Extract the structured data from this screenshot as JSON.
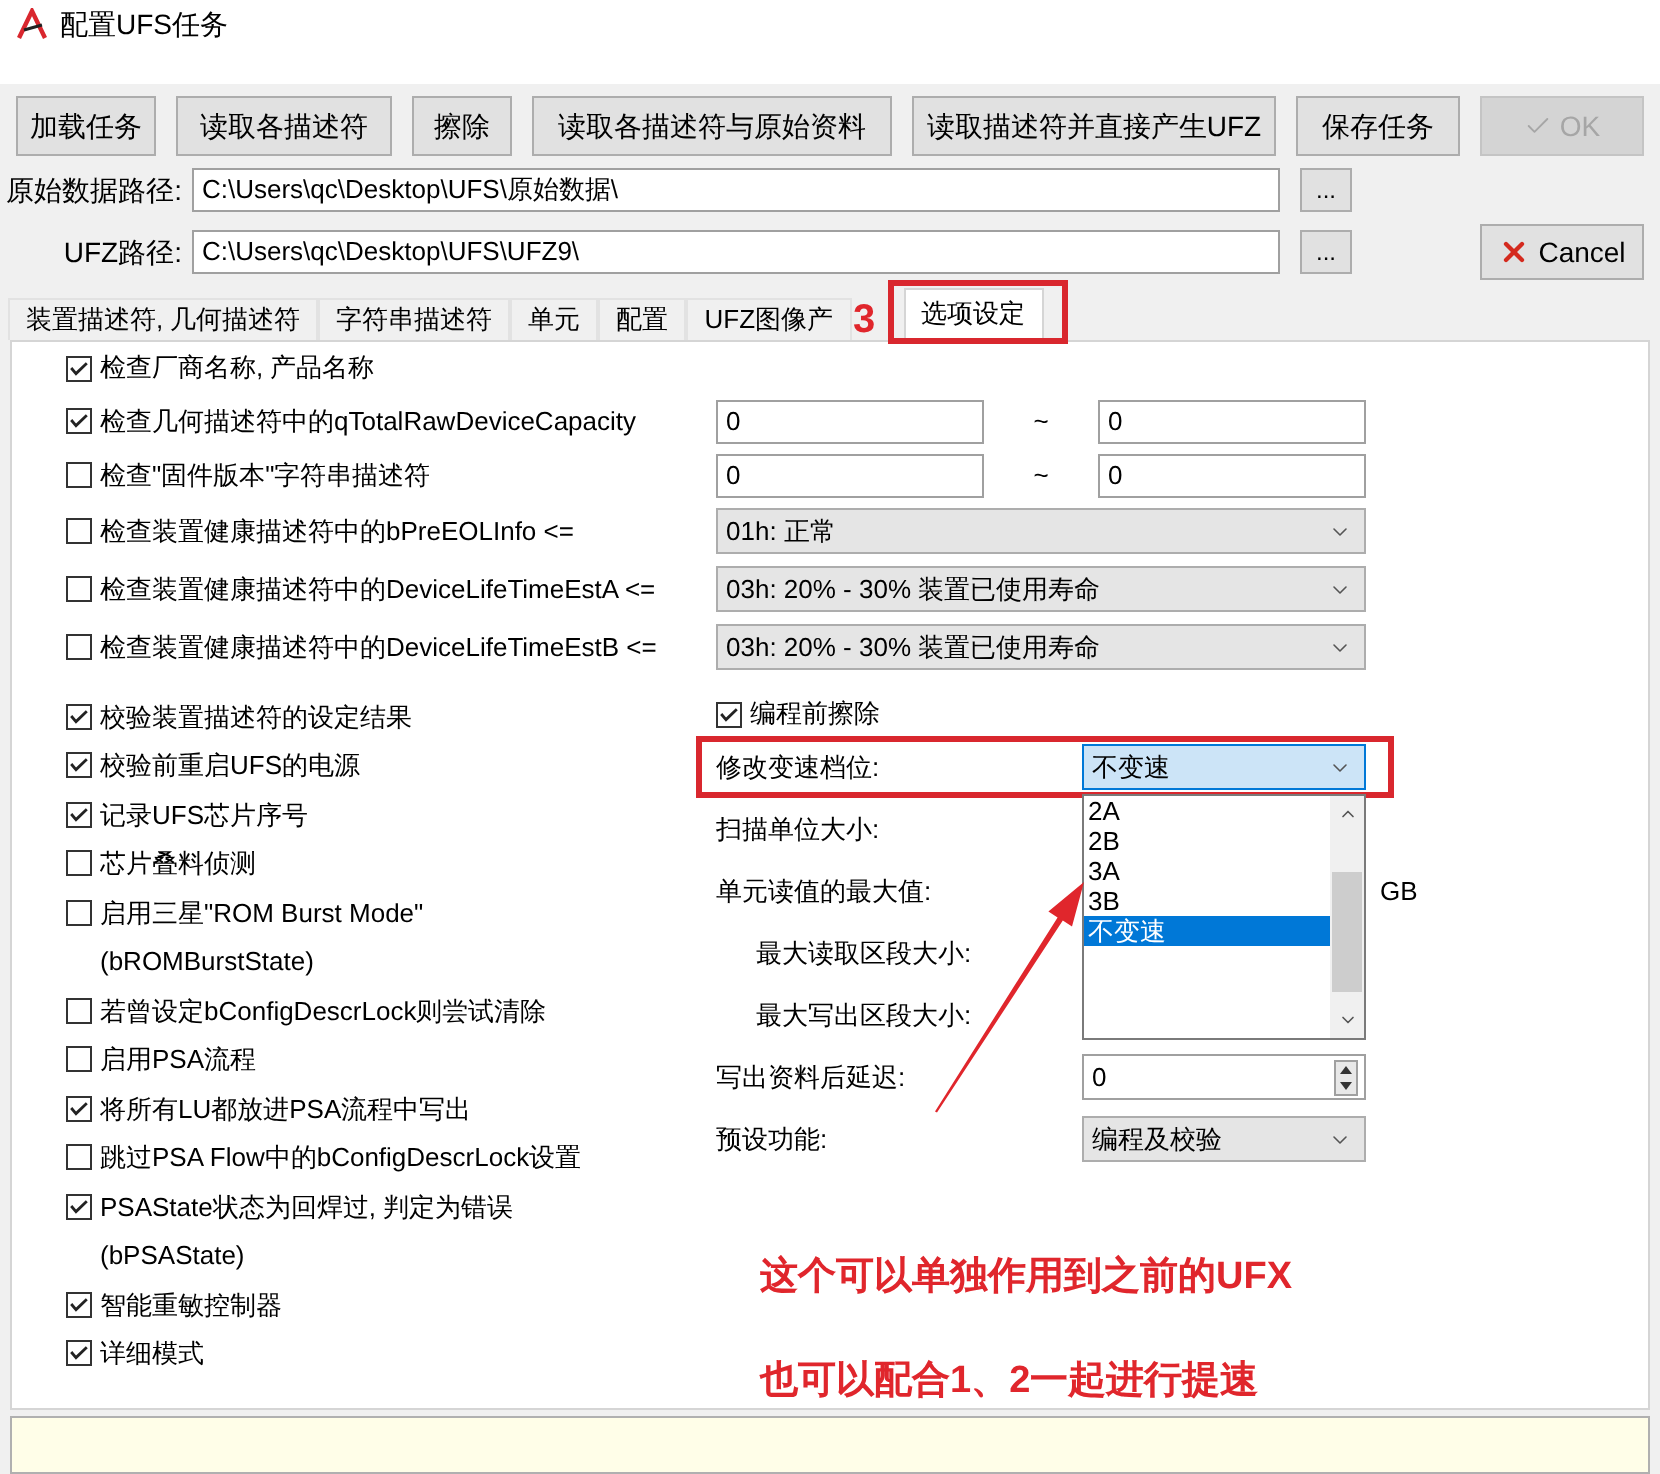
{
  "window": {
    "title": "配置UFS任务"
  },
  "toolbar": {
    "buttons": [
      {
        "label": "加载任务"
      },
      {
        "label": "读取各描述符"
      },
      {
        "label": "擦除"
      },
      {
        "label": "读取各描述符与原始资料"
      },
      {
        "label": "读取描述符并直接产生UFZ"
      },
      {
        "label": "保存任务"
      }
    ],
    "ok": {
      "label": "OK",
      "disabled": true
    }
  },
  "paths": [
    {
      "label": "原始数据路径:",
      "value": "C:\\Users\\qc\\Desktop\\UFS\\原始数据\\",
      "browse": "..."
    },
    {
      "label": "UFZ路径:",
      "value": "C:\\Users\\qc\\Desktop\\UFS\\UFZ9\\",
      "browse": "..."
    }
  ],
  "cancel": {
    "label": "Cancel"
  },
  "tabs": [
    {
      "label": "装置描述符, 几何描述符",
      "selected": false,
      "annotated": false
    },
    {
      "label": "字符串描述符",
      "selected": false,
      "annotated": false
    },
    {
      "label": "单元",
      "selected": false,
      "annotated": false
    },
    {
      "label": "配置",
      "selected": false,
      "annotated": false
    },
    {
      "label": "UFZ图像产",
      "selected": false,
      "annotated": false
    },
    {
      "label": "选项设定",
      "selected": true,
      "annotated": true
    }
  ],
  "tab_marker": "3",
  "top_rows": [
    {
      "label": "检查厂商名称, 产品名称",
      "checked": true
    },
    {
      "label": "检查几何描述符中的qTotalRawDeviceCapacity",
      "checked": true,
      "control": {
        "kind": "range",
        "from": "0",
        "separator": "~",
        "to": "0"
      }
    },
    {
      "label": "检查\"固件版本\"字符串描述符",
      "checked": false,
      "control": {
        "kind": "range",
        "from": "0",
        "separator": "~",
        "to": "0"
      }
    },
    {
      "label": "检查装置健康描述符中的bPreEOLInfo <=",
      "checked": false,
      "control": {
        "kind": "select",
        "value": "01h: 正常"
      }
    },
    {
      "label": "检查装置健康描述符中的DeviceLifeTimeEstA <=",
      "checked": false,
      "control": {
        "kind": "select",
        "value": "03h: 20% - 30% 装置已使用寿命"
      }
    },
    {
      "label": "检查装置健康描述符中的DeviceLifeTimeEstB <=",
      "checked": false,
      "control": {
        "kind": "select",
        "value": "03h: 20% - 30% 装置已使用寿命"
      }
    }
  ],
  "left_options": [
    {
      "label": "校验装置描述符的设定结果",
      "checked": true
    },
    {
      "label": "校验前重启UFS的电源",
      "checked": true
    },
    {
      "label": "记录UFS芯片序号",
      "checked": true
    },
    {
      "label": "芯片叠料侦测",
      "checked": false
    },
    {
      "label": "启用三星\"ROM Burst Mode\"",
      "note": "(bROMBurstState)",
      "checked": false
    },
    {
      "label": "若曾设定bConfigDescrLock则尝试清除",
      "checked": false
    },
    {
      "label": "启用PSA流程",
      "checked": false
    },
    {
      "label": "将所有LU都放进PSA流程中写出",
      "checked": true
    },
    {
      "label": "跳过PSA Flow中的bConfigDescrLock设置",
      "checked": false
    },
    {
      "label": "PSAState状态为回焊过, 判定为错误",
      "note": "(bPSAState)",
      "checked": true
    },
    {
      "label": "智能重敏控制器",
      "checked": true
    },
    {
      "label": "详细模式",
      "checked": true
    }
  ],
  "right_panel": {
    "erase": {
      "label": "编程前擦除",
      "checked": true
    },
    "fields": [
      {
        "kind": "select",
        "label": "修改变速档位:",
        "value": "不变速",
        "open": true,
        "annotated": true,
        "options": [
          {
            "label": "2A",
            "selected": false
          },
          {
            "label": "2B",
            "selected": false
          },
          {
            "label": "3A",
            "selected": false
          },
          {
            "label": "3B",
            "selected": false
          },
          {
            "label": "不变速",
            "selected": true
          }
        ]
      },
      {
        "kind": "label",
        "label": "扫描单位大小:"
      },
      {
        "kind": "unit",
        "label": "单元读值的最大值:",
        "unit": "GB"
      },
      {
        "kind": "sublabel",
        "label": "最大读取区段大小:"
      },
      {
        "kind": "sublabel",
        "label": "最大写出区段大小:"
      },
      {
        "kind": "spin",
        "label": "写出资料后延迟:",
        "value": "0"
      },
      {
        "kind": "select",
        "label": "预设功能:",
        "value": "编程及校验",
        "open": false,
        "annotated": false
      }
    ]
  },
  "notes": [
    "这个可以单独作用到之前的UFX",
    "也可以配合1、2一起进行提速"
  ]
}
